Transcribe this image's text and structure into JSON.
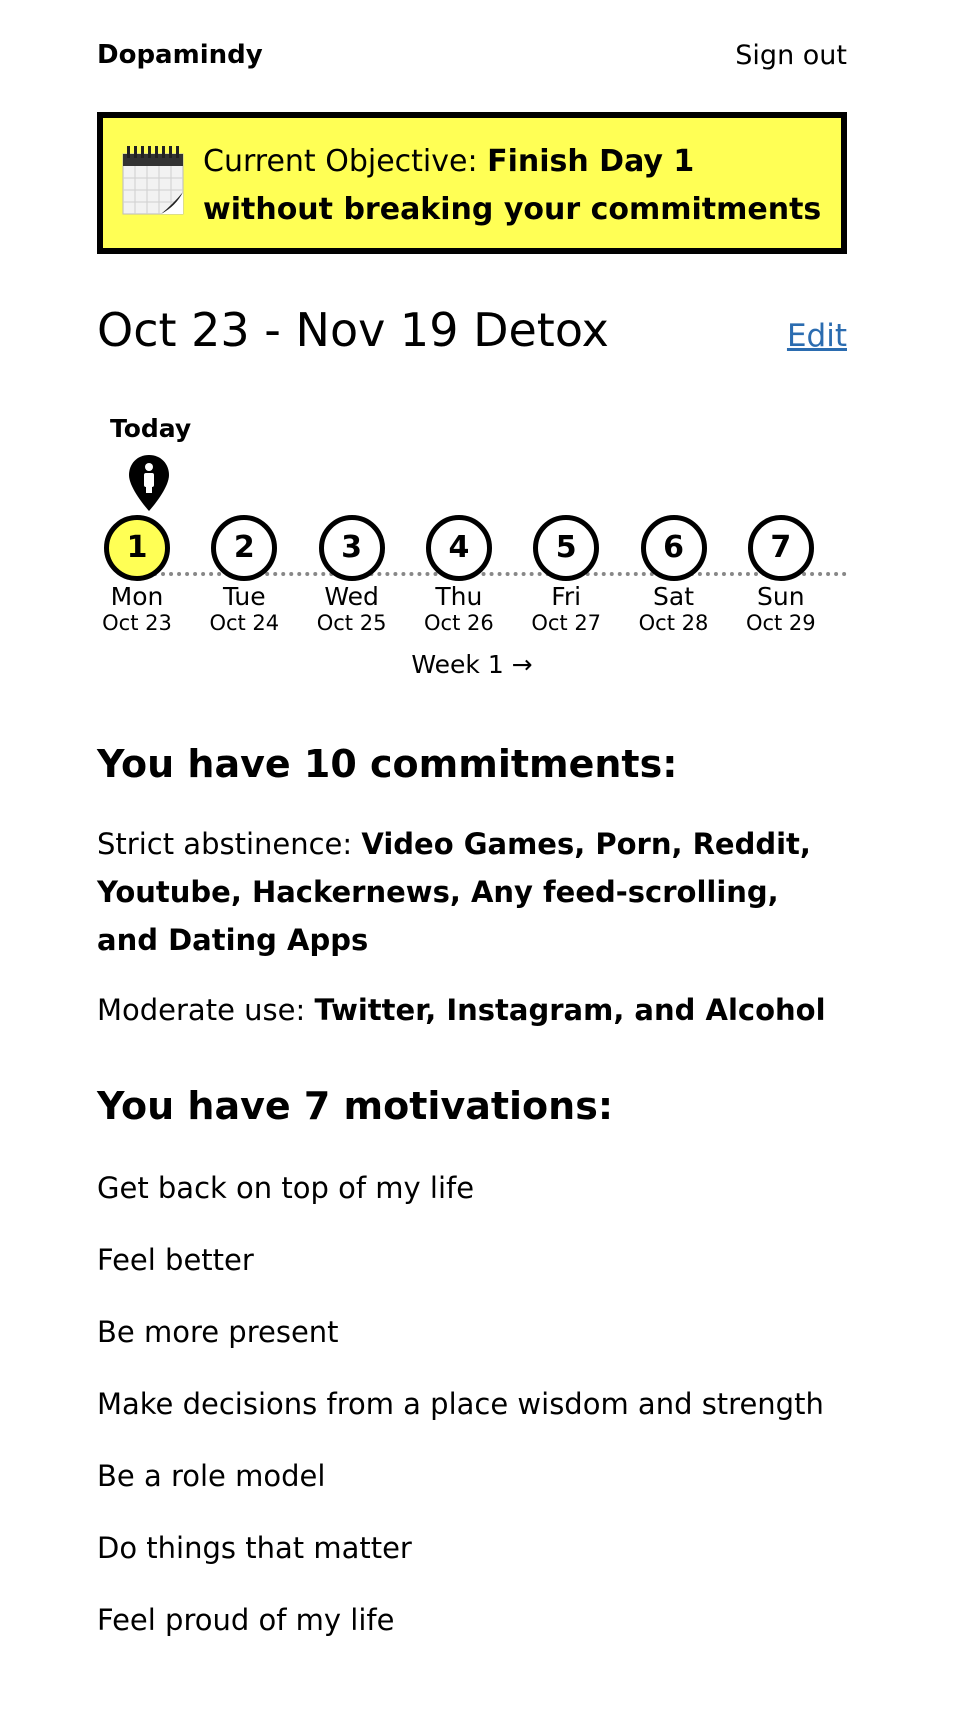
{
  "header": {
    "brand": "Dopamindy",
    "signout_label": "Sign out"
  },
  "objective": {
    "prefix": "Current Objective: ",
    "bold": "Finish Day 1 without breaking your commitments",
    "icon": "calendar-icon"
  },
  "detox": {
    "title": "Oct 23 - Nov 19 Detox",
    "edit_label": "Edit"
  },
  "timeline": {
    "today_label": "Today",
    "current_index": 0,
    "days": [
      {
        "num": "1",
        "name": "Mon",
        "date": "Oct 23"
      },
      {
        "num": "2",
        "name": "Tue",
        "date": "Oct 24"
      },
      {
        "num": "3",
        "name": "Wed",
        "date": "Oct 25"
      },
      {
        "num": "4",
        "name": "Thu",
        "date": "Oct 26"
      },
      {
        "num": "5",
        "name": "Fri",
        "date": "Oct 27"
      },
      {
        "num": "6",
        "name": "Sat",
        "date": "Oct 28"
      },
      {
        "num": "7",
        "name": "Sun",
        "date": "Oct 29"
      }
    ],
    "week_link": "Week 1 →",
    "accent": "#ffff55"
  },
  "commitments": {
    "heading": "You have 10 commitments:",
    "strict_label": "Strict abstinence: ",
    "strict_items": "Video Games, Porn, Reddit, Youtube, Hackernews, Any feed-scrolling, and Dating Apps",
    "moderate_label": "Moderate use: ",
    "moderate_items": "Twitter, Instagram, and Alcohol"
  },
  "motivations": {
    "heading": "You have 7 motivations:",
    "items": [
      "Get back on top of my life",
      "Feel better",
      "Be more present",
      "Make decisions from a place wisdom and strength",
      "Be a role model",
      "Do things that matter",
      "Feel proud of my life"
    ]
  },
  "colors": {
    "link": "#2b6cb0",
    "highlight": "#ffff55"
  }
}
